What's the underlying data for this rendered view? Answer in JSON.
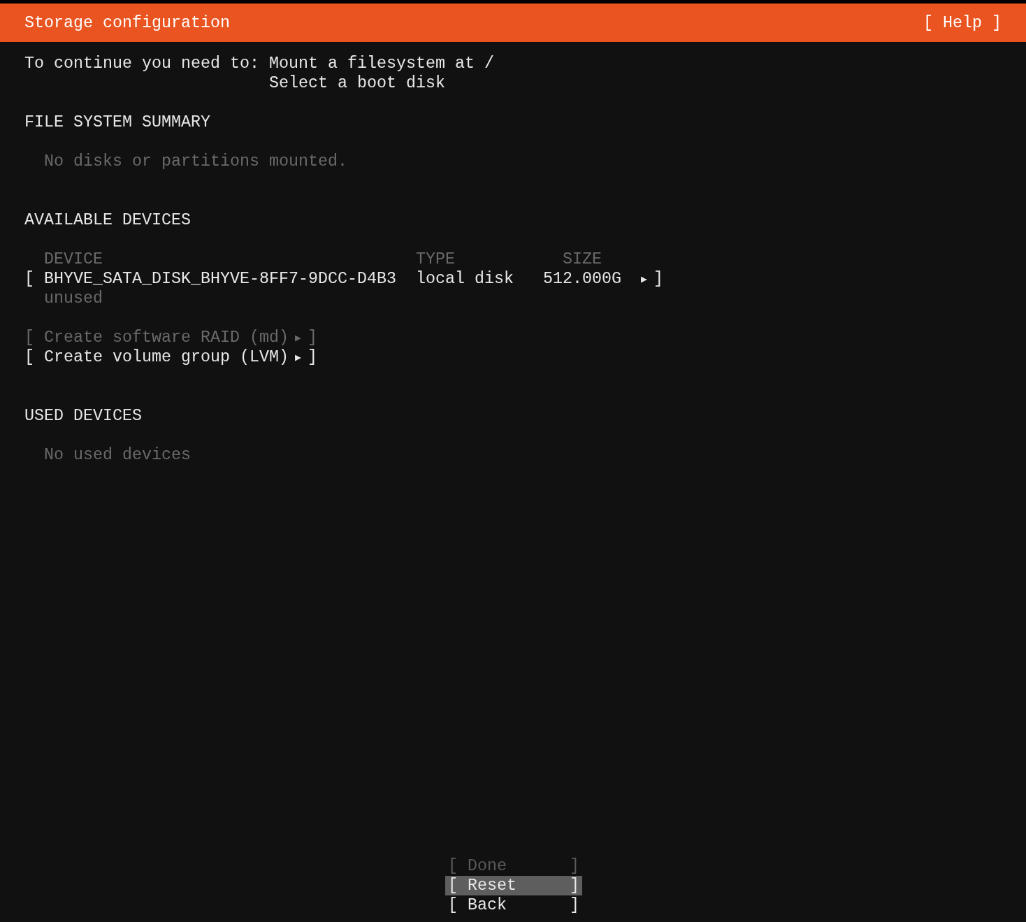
{
  "header": {
    "title": "Storage configuration",
    "help": "[ Help ]"
  },
  "requirements": {
    "label": "To continue you need to:",
    "items": [
      "Mount a filesystem at /",
      "Select a boot disk"
    ]
  },
  "file_system_summary": {
    "heading": "FILE SYSTEM SUMMARY",
    "empty_text": "No disks or partitions mounted."
  },
  "available_devices": {
    "heading": "AVAILABLE DEVICES",
    "columns": [
      "DEVICE",
      "TYPE",
      "SIZE"
    ],
    "devices": [
      {
        "open": "[",
        "name": "BHYVE_SATA_DISK_BHYVE-8FF7-9DCC-D4B3",
        "type": "local disk",
        "size": "512.000G",
        "arrow": "▶",
        "close": "]",
        "status": "unused"
      }
    ],
    "actions": [
      {
        "open": "[",
        "label": "Create software RAID (md)",
        "arrow": "▶",
        "close": "]",
        "disabled": true
      },
      {
        "open": "[",
        "label": "Create volume group (LVM)",
        "arrow": "▶",
        "close": "]",
        "disabled": false
      }
    ]
  },
  "used_devices": {
    "heading": "USED DEVICES",
    "empty_text": "No used devices"
  },
  "buttons": [
    {
      "open": "[",
      "label": "Done",
      "close": "]",
      "disabled": true,
      "selected": false
    },
    {
      "open": "[",
      "label": "Reset",
      "close": "]",
      "disabled": false,
      "selected": true
    },
    {
      "open": "[",
      "label": "Back",
      "close": "]",
      "disabled": false,
      "selected": false
    }
  ]
}
